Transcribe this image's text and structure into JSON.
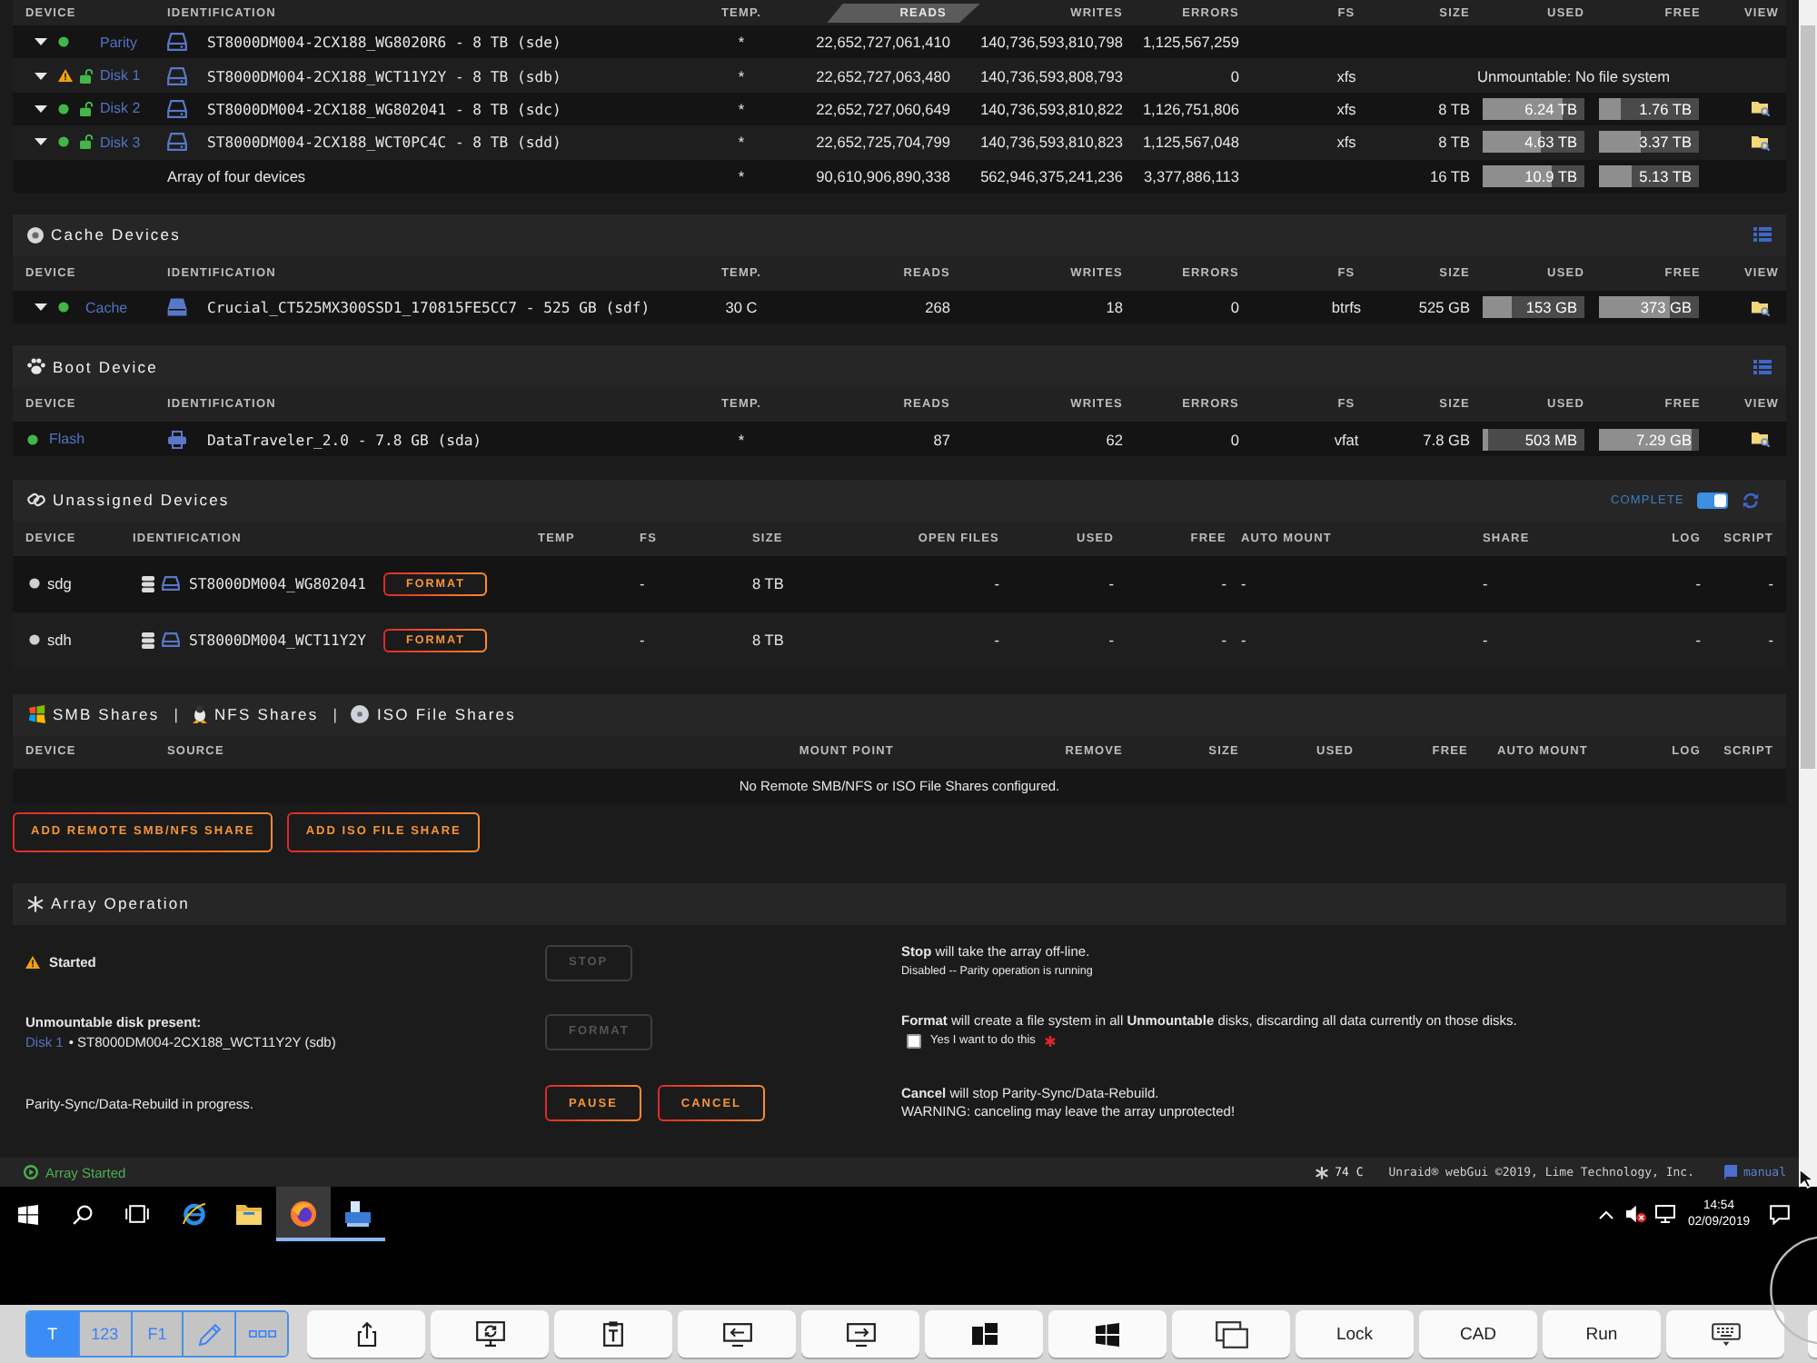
{
  "array_devices": {
    "columns": [
      {
        "label": "DEVICE",
        "selected": false
      },
      {
        "label": "IDENTIFICATION",
        "selected": false
      },
      {
        "label": "TEMP.",
        "selected": false
      },
      {
        "label": "READS",
        "selected": true
      },
      {
        "label": "WRITES",
        "selected": false
      },
      {
        "label": "ERRORS",
        "selected": false
      },
      {
        "label": "FS",
        "selected": false
      },
      {
        "label": "SIZE",
        "selected": false
      },
      {
        "label": "USED",
        "selected": false
      },
      {
        "label": "FREE",
        "selected": false
      },
      {
        "label": "VIEW",
        "selected": false
      }
    ],
    "rows": [
      {
        "kind": "device",
        "device": "Parity",
        "warning": false,
        "expander": true,
        "padlock": false,
        "identification": "ST8000DM004-2CX188_WG8020R6 - 8 TB (sde)",
        "temp": "*",
        "reads": "22,652,727,061,410",
        "writes": "140,736,593,810,798",
        "errors": "1,125,567,259",
        "view": false
      },
      {
        "kind": "device",
        "device": "Disk 1",
        "warning": true,
        "expander": true,
        "padlock": true,
        "identification": "ST8000DM004-2CX188_WCT11Y2Y - 8 TB (sdb)",
        "temp": "*",
        "reads": "22,652,727,063,480",
        "writes": "140,736,593,808,793",
        "errors": "0",
        "fs": "xfs",
        "note": "Unmountable: No file system",
        "view": false
      },
      {
        "kind": "device",
        "device": "Disk 2",
        "warning": false,
        "expander": true,
        "padlock": true,
        "identification": "ST8000DM004-2CX188_WG802041 - 8 TB (sdc)",
        "temp": "*",
        "reads": "22,652,727,060,649",
        "writes": "140,736,593,810,822",
        "errors": "1,126,751,806",
        "fs": "xfs",
        "size": "8 TB",
        "used": {
          "text": "6.24 TB",
          "level": 0.78
        },
        "free": {
          "text": "1.76 TB",
          "level": 0.22
        },
        "view": true
      },
      {
        "kind": "device",
        "device": "Disk 3",
        "warning": false,
        "expander": true,
        "padlock": true,
        "identification": "ST8000DM004-2CX188_WCT0PC4C - 8 TB (sdd)",
        "temp": "*",
        "reads": "22,652,725,704,799",
        "writes": "140,736,593,810,823",
        "errors": "1,125,567,048",
        "fs": "xfs",
        "size": "8 TB",
        "used": {
          "text": "4.63 TB",
          "level": 0.58
        },
        "free": {
          "text": "3.37 TB",
          "level": 0.42
        },
        "view": true
      },
      {
        "kind": "total",
        "identification": "Array of four devices",
        "temp": "*",
        "reads": "90,610,906,890,338",
        "writes": "562,946,375,241,236",
        "errors": "3,377,886,113",
        "size": "16 TB",
        "used": {
          "text": "10.9 TB",
          "level": 0.68
        },
        "free": {
          "text": "5.13 TB",
          "level": 0.32
        },
        "view": false
      }
    ]
  },
  "cache_devices": {
    "title": "Cache Devices",
    "columns": [
      "DEVICE",
      "IDENTIFICATION",
      "TEMP.",
      "READS",
      "WRITES",
      "ERRORS",
      "FS",
      "SIZE",
      "USED",
      "FREE",
      "VIEW"
    ],
    "rows": [
      {
        "kind": "device",
        "device": "Cache",
        "warning": false,
        "expander": true,
        "padlock": false,
        "identification": "Crucial_CT525MX300SSD1_170815FE5CC7 - 525 GB (sdf)",
        "temp": "30 C",
        "reads": "268",
        "writes": "18",
        "errors": "0",
        "fs": "btrfs",
        "size": "525 GB",
        "used": {
          "text": "153 GB",
          "level": 0.29
        },
        "free": {
          "text": "373 GB",
          "level": 0.71
        },
        "view": true
      }
    ]
  },
  "boot_device": {
    "title": "Boot Device",
    "columns": [
      "DEVICE",
      "IDENTIFICATION",
      "TEMP.",
      "READS",
      "WRITES",
      "ERRORS",
      "FS",
      "SIZE",
      "USED",
      "FREE",
      "VIEW"
    ],
    "rows": [
      {
        "kind": "device",
        "device": "Flash",
        "warning": false,
        "expander": false,
        "padlock": false,
        "identification": "DataTraveler_2.0 - 7.8 GB (sda)",
        "temp": "*",
        "reads": "87",
        "writes": "62",
        "errors": "0",
        "fs": "vfat",
        "size": "7.8 GB",
        "used": {
          "text": "503 MB",
          "level": 0.06
        },
        "free": {
          "text": "7.29 GB",
          "level": 0.93
        },
        "view": true
      }
    ]
  },
  "unassigned_devices": {
    "title": "Unassigned Devices",
    "toggle": {
      "label": "COMPLETE",
      "on": true
    },
    "columns": [
      "DEVICE",
      "IDENTIFICATION",
      "TEMP",
      "FS",
      "SIZE",
      "OPEN FILES",
      "USED",
      "FREE",
      "AUTO MOUNT",
      "SHARE",
      "LOG",
      "SCRIPT"
    ],
    "rows": [
      {
        "device": "sdg",
        "identification": "ST8000DM004_WG802041",
        "action": "FORMAT",
        "fs": "-",
        "size": "8 TB",
        "open_files": "-",
        "used": "-",
        "free": "-",
        "auto_mount": "-",
        "share": "-",
        "log": "-",
        "script": "-"
      },
      {
        "device": "sdh",
        "identification": "ST8000DM004_WCT11Y2Y",
        "action": "FORMAT",
        "fs": "-",
        "size": "8 TB",
        "open_files": "-",
        "used": "-",
        "free": "-",
        "auto_mount": "-",
        "share": "-",
        "log": "-",
        "script": "-"
      }
    ]
  },
  "remote_shares": {
    "tabs": [
      {
        "kind": "smb",
        "label": "SMB Shares"
      },
      {
        "kind": "separator",
        "label": "|"
      },
      {
        "kind": "nfs",
        "label": "NFS Shares"
      },
      {
        "kind": "separator",
        "label": "|"
      },
      {
        "kind": "iso",
        "label": "ISO File Shares"
      }
    ],
    "columns": [
      "DEVICE",
      "SOURCE",
      "MOUNT POINT",
      "REMOVE",
      "SIZE",
      "USED",
      "FREE",
      "AUTO MOUNT",
      "LOG",
      "SCRIPT"
    ],
    "empty_message": "No Remote SMB/NFS or ISO File Shares configured.",
    "buttons": [
      "ADD REMOTE SMB/NFS SHARE",
      "ADD ISO FILE SHARE"
    ]
  },
  "array_operation": {
    "title": "Array Operation",
    "rows": [
      {
        "warning": true,
        "heading": "Started",
        "buttons": [
          {
            "label": "STOP",
            "disabled": true
          }
        ],
        "info": [
          {
            "kind": "main",
            "text": "**Stop** will take the array off-line."
          },
          {
            "kind": "note",
            "text": "Disabled -- Parity operation is running"
          }
        ]
      },
      {
        "warning": false,
        "heading": "Unmountable disk present:",
        "disk_link": "Disk 1",
        "disk_detail": "• ST8000DM004-2CX188_WCT11Y2Y (sdb)",
        "buttons": [
          {
            "label": "FORMAT",
            "disabled": true
          }
        ],
        "info": [
          {
            "kind": "main",
            "text": "**Format** will create a file system in all **Unmountable** disks, discarding all data currently on those disks."
          }
        ],
        "confirm": {
          "label": "Yes I want to do this",
          "checked": false,
          "required": true
        }
      },
      {
        "warning": false,
        "text": "Parity-Sync/Data-Rebuild in progress.",
        "buttons": [
          {
            "label": "PAUSE",
            "disabled": false
          },
          {
            "label": "CANCEL",
            "disabled": false
          }
        ],
        "info": [
          {
            "kind": "main",
            "text": "**Cancel** will stop Parity-Sync/Data-Rebuild."
          },
          {
            "kind": "main",
            "text": "WARNING: canceling may leave the array unprotected!"
          }
        ]
      }
    ]
  },
  "status_bar": {
    "array_state": "Array Started",
    "cpu_temp": "74 C",
    "copyright": "Unraid® webGui ©2019, Lime Technology, Inc.",
    "manual": "manual"
  },
  "taskbar": {
    "apps": [
      {
        "kind": "e-logo",
        "selected": false,
        "running": false
      },
      {
        "kind": "folder",
        "selected": false,
        "running": false
      },
      {
        "kind": "fox",
        "selected": true,
        "running": true
      },
      {
        "kind": "app",
        "selected": false,
        "running": true
      }
    ],
    "time": "14:54",
    "date": "02/09/2019"
  },
  "toolbar": {
    "modes": [
      {
        "kind": "text",
        "label": "T",
        "selected": true
      },
      {
        "kind": "text",
        "label": "123",
        "selected": false
      },
      {
        "kind": "text",
        "label": "F1",
        "selected": false
      },
      {
        "kind": "pencil",
        "selected": false
      },
      {
        "kind": "dots",
        "selected": false
      }
    ],
    "buttons": [
      {
        "kind": "share"
      },
      {
        "kind": "monitor-sync"
      },
      {
        "kind": "clipboard"
      },
      {
        "kind": "screen-left"
      },
      {
        "kind": "screen-right"
      },
      {
        "kind": "tiles"
      },
      {
        "kind": "windows"
      },
      {
        "kind": "stack"
      },
      {
        "kind": "text",
        "label": "Lock"
      },
      {
        "kind": "text",
        "label": "CAD"
      },
      {
        "kind": "text",
        "label": "Run"
      },
      {
        "kind": "keyboard"
      }
    ]
  }
}
